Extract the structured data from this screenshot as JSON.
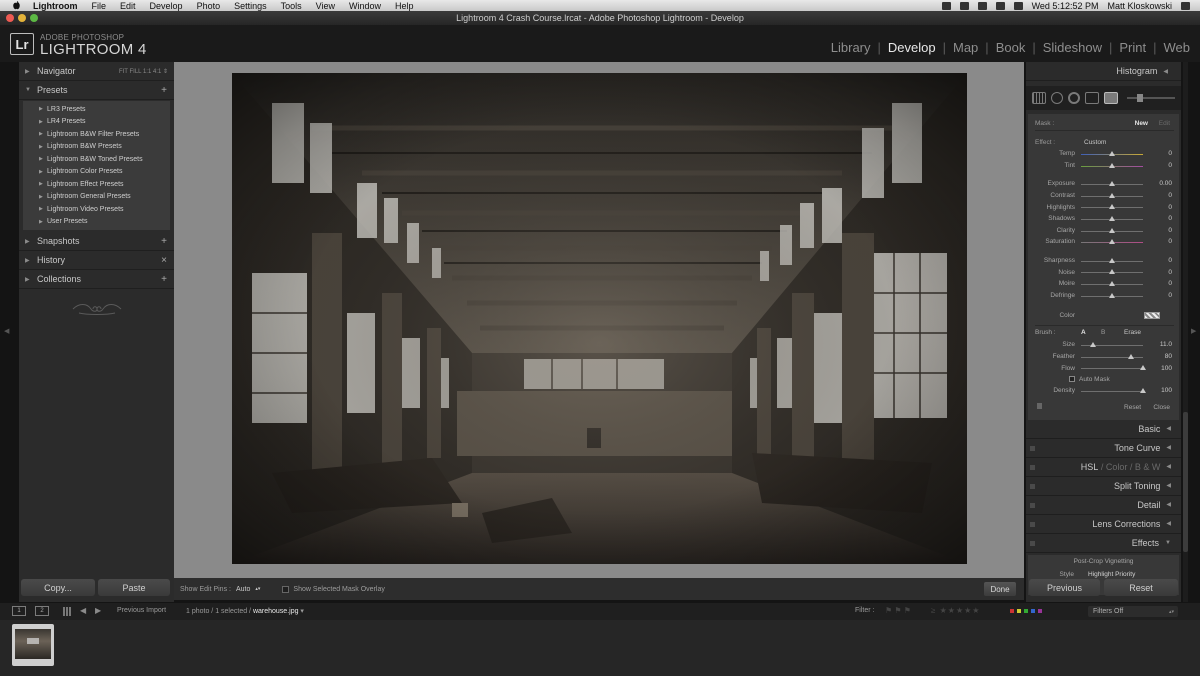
{
  "menubar": {
    "app": "Lightroom",
    "items": [
      "File",
      "Edit",
      "Develop",
      "Photo",
      "Settings",
      "Tools",
      "View",
      "Window",
      "Help"
    ],
    "clock": "Wed 5:12:52 PM",
    "user": "Matt Kloskowski"
  },
  "window": {
    "title": "Lightroom 4 Crash Course.lrcat - Adobe Photoshop Lightroom - Develop"
  },
  "identity": {
    "logo": "Lr",
    "top": "ADOBE PHOTOSHOP",
    "main": "LIGHTROOM 4"
  },
  "modules": [
    "Library",
    "Develop",
    "Map",
    "Book",
    "Slideshow",
    "Print",
    "Web"
  ],
  "left_panel": {
    "navigator": {
      "label": "Navigator",
      "zoom": "FIT  FILL  1:1  4:1 ⇕"
    },
    "presets": {
      "label": "Presets",
      "items": [
        "LR3 Presets",
        "LR4 Presets",
        "Lightroom B&W Filter Presets",
        "Lightroom B&W Presets",
        "Lightroom B&W Toned Presets",
        "Lightroom Color Presets",
        "Lightroom Effect Presets",
        "Lightroom General Presets",
        "Lightroom Video Presets",
        "User Presets"
      ]
    },
    "snapshots": "Snapshots",
    "history": "History",
    "collections": "Collections",
    "copy": "Copy...",
    "paste": "Paste"
  },
  "toolbar": {
    "pins_label": "Show Edit Pins :",
    "pins_value": "Auto",
    "mask_overlay": "Show Selected Mask Overlay",
    "done": "Done"
  },
  "right_panel": {
    "histogram": "Histogram",
    "mask": {
      "label": "Mask :",
      "new": "New",
      "edit": "Edit"
    },
    "effect": {
      "label": "Effect :",
      "value": "Custom"
    },
    "sliders_group1": [
      {
        "label": "Temp",
        "value": "0",
        "pos": 0.5,
        "cls": "temp"
      },
      {
        "label": "Tint",
        "value": "0",
        "pos": 0.5,
        "cls": "tint"
      }
    ],
    "sliders_group2": [
      {
        "label": "Exposure",
        "value": "0.00",
        "pos": 0.5,
        "cls": ""
      },
      {
        "label": "Contrast",
        "value": "0",
        "pos": 0.5,
        "cls": ""
      },
      {
        "label": "Highlights",
        "value": "0",
        "pos": 0.5,
        "cls": ""
      },
      {
        "label": "Shadows",
        "value": "0",
        "pos": 0.5,
        "cls": ""
      },
      {
        "label": "Clarity",
        "value": "0",
        "pos": 0.5,
        "cls": ""
      },
      {
        "label": "Saturation",
        "value": "0",
        "pos": 0.5,
        "cls": "sat"
      }
    ],
    "sliders_group3": [
      {
        "label": "Sharpness",
        "value": "0",
        "pos": 0.5,
        "cls": ""
      },
      {
        "label": "Noise",
        "value": "0",
        "pos": 0.5,
        "cls": ""
      },
      {
        "label": "Moire",
        "value": "0",
        "pos": 0.5,
        "cls": ""
      },
      {
        "label": "Defringe",
        "value": "0",
        "pos": 0.5,
        "cls": ""
      }
    ],
    "color_label": "Color",
    "brush": {
      "label": "Brush :",
      "a": "A",
      "b": "B",
      "erase": "Erase"
    },
    "brush_sliders": [
      {
        "label": "Size",
        "value": "11.0",
        "pos": 0.2,
        "cls": ""
      },
      {
        "label": "Feather",
        "value": "80",
        "pos": 0.8,
        "cls": ""
      },
      {
        "label": "Flow",
        "value": "100",
        "pos": 1.0,
        "cls": ""
      }
    ],
    "auto_mask": "Auto Mask",
    "density": {
      "label": "Density",
      "value": "100",
      "pos": 1.0,
      "cls": ""
    },
    "reset": "Reset",
    "close": "Close",
    "sections": {
      "basic": "Basic",
      "tone_curve": "Tone Curve",
      "hsl": "HSL",
      "color": "Color",
      "bw": "B & W",
      "split_toning": "Split Toning",
      "detail": "Detail",
      "lens": "Lens Corrections",
      "effects": "Effects"
    },
    "effects_sub": {
      "title": "Post-Crop Vignetting",
      "style_label": "Style",
      "style_value": "Highlight Priority"
    },
    "previous": "Previous",
    "reset_btn": "Reset"
  },
  "filmstrip": {
    "screen1": "1",
    "screen2": "2",
    "source": "Previous Import",
    "count": "1 photo / 1 selected /",
    "filename": "warehouse.jpg",
    "filter_label": "Filter :",
    "filter_value": "Filters Off"
  }
}
